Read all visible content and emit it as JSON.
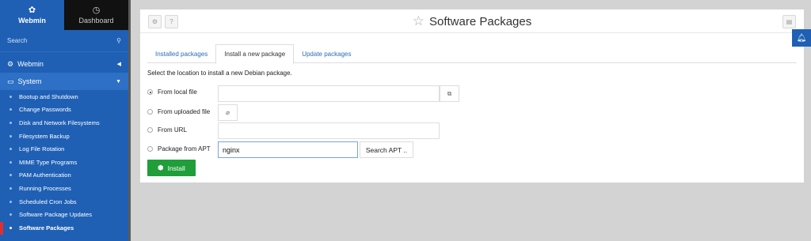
{
  "sidebar": {
    "tabs": [
      {
        "label": "Webmin",
        "icon": "webmin-logo-icon"
      },
      {
        "label": "Dashboard",
        "icon": "dashboard-icon"
      }
    ],
    "search_placeholder": "Search",
    "categories": [
      {
        "label": "Webmin",
        "icon": "gear-icon",
        "expanded": false
      },
      {
        "label": "System",
        "icon": "monitor-icon",
        "expanded": true
      }
    ],
    "items": [
      "Bootup and Shutdown",
      "Change Passwords",
      "Disk and Network Filesystems",
      "Filesystem Backup",
      "Log File Rotation",
      "MIME Type Programs",
      "PAM Authentication",
      "Running Processes",
      "Scheduled Cron Jobs",
      "Software Package Updates",
      "Software Packages"
    ],
    "active_item": "Software Packages"
  },
  "header": {
    "title": "Software Packages"
  },
  "tabs": [
    {
      "label": "Installed packages",
      "active": false
    },
    {
      "label": "Install a new package",
      "active": true
    },
    {
      "label": "Update packages",
      "active": false
    }
  ],
  "form": {
    "intro": "Select the location to install a new Debian package.",
    "options": {
      "local": {
        "label": "From local file",
        "selected": true,
        "value": ""
      },
      "uploaded": {
        "label": "From uploaded file",
        "selected": false
      },
      "url": {
        "label": "From URL",
        "selected": false,
        "value": ""
      },
      "apt": {
        "label": "Package from APT",
        "selected": false,
        "value": "nginx"
      }
    },
    "search_apt_label": "Search APT ..",
    "install_label": "Install"
  },
  "colors": {
    "sidebar_bg": "#1f60b5",
    "install_green": "#1f9e3a",
    "link_blue": "#2b6cb8"
  }
}
